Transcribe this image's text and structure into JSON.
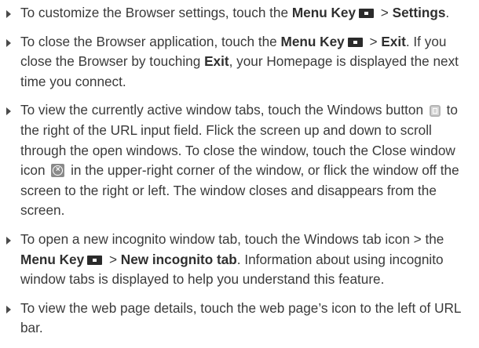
{
  "items": [
    {
      "t1": "To customize the Browser settings, touch the ",
      "menu_key": "Menu Key",
      "t2": " > ",
      "target": "Settings",
      "t3": "."
    },
    {
      "t1": "To close the Browser application, touch the ",
      "menu_key": "Menu Key",
      "t2": " > ",
      "target": "Exit",
      "t3": ". If you close the Browser by touching ",
      "target2": "Exit",
      "t4": ", your Homepage is displayed the next time you connect."
    },
    {
      "t1": "To view the currently active window tabs, touch the Windows button ",
      "t2": " to the right of the URL input field. Flick the screen up and down to scroll through the open windows. To close the window, touch the Close window icon ",
      "t3": " in the upper-right corner of the window, or flick the window off the screen to the right or left. The window closes and disappears from the screen."
    },
    {
      "t1": "To open a new incognito window tab, touch the Windows tab icon > the ",
      "menu_key": "Menu Key",
      "t2": " > ",
      "target": "New incognito tab",
      "t3": ". Information about using incognito window tabs is displayed to help you understand this feature."
    },
    {
      "t1": "To view the web page details, touch the web page’s icon to the left of URL bar."
    }
  ],
  "icons": {
    "menu_key_icon": "menu-key-icon",
    "windows_button_icon": "windows-button-icon",
    "close_window_icon": "close-window-icon"
  }
}
